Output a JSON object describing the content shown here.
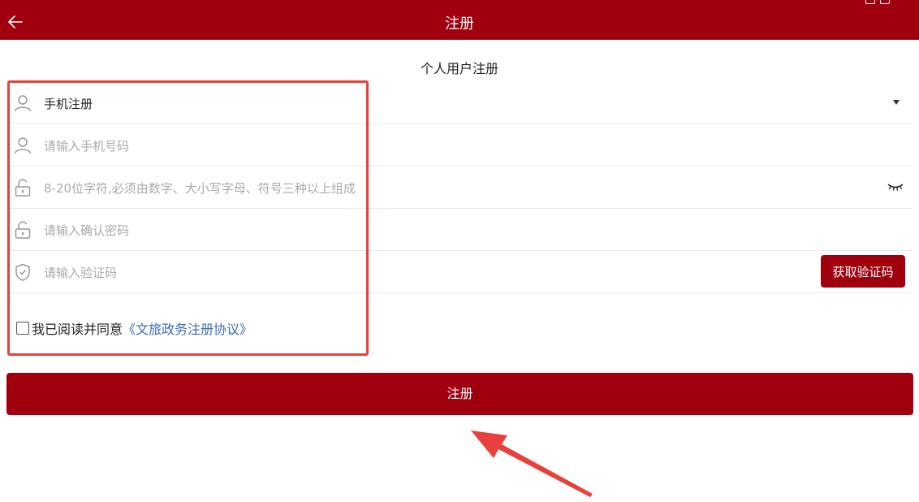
{
  "header": {
    "title": "注册",
    "status_left": "...",
    "accent_color": "#a0000e"
  },
  "form": {
    "subtitle": "个人用户注册",
    "register_type": {
      "value": "手机注册"
    },
    "phone": {
      "placeholder": "请输入手机号码"
    },
    "password": {
      "placeholder": "8-20位字符,必须由数字、大小写字母、符号三种以上组成"
    },
    "confirm_password": {
      "placeholder": "请输入确认密码"
    },
    "verify_code": {
      "placeholder": "请输入验证码",
      "button_label": "获取验证码"
    },
    "agreement": {
      "text": "我已阅读并同意",
      "link": "《文旅政务注册协议》",
      "checked": false
    },
    "submit_label": "注册"
  },
  "icons": {
    "back": "back-arrow-icon",
    "user": "user-icon",
    "lock": "lock-icon",
    "shield": "shield-check-icon",
    "eye": "eye-closed-icon",
    "dropdown": "caret-down-icon"
  },
  "annotation": {
    "highlight_color": "#e8403a"
  }
}
